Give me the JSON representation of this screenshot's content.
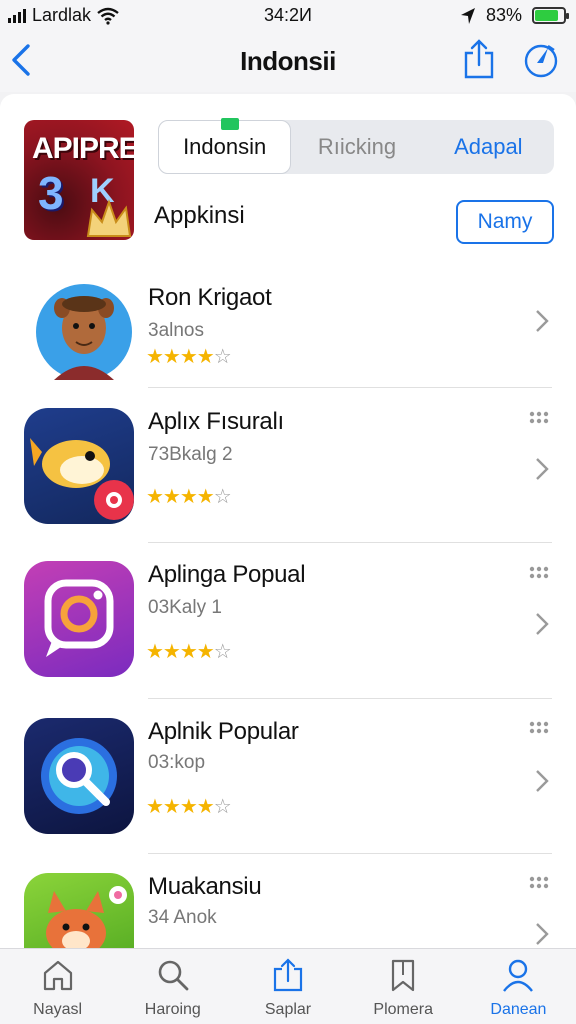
{
  "status_bar": {
    "carrier": "Lardlak",
    "time": "34:2И",
    "battery_percent": "83%",
    "battery_level": 0.83
  },
  "nav": {
    "title": "Indonsii",
    "back_icon": "chevron-left-icon",
    "share_icon": "share-icon",
    "compass_icon": "compass-icon"
  },
  "featured": {
    "icon_text_top": "APIPRE",
    "icon_text_num": "3",
    "icon_text_letter": "K",
    "segments": [
      "Indonsin",
      "Rıicking",
      "Adapal"
    ],
    "selected_segment": 0,
    "label": "Appkinsi",
    "action_label": "Namy"
  },
  "apps": [
    {
      "name": "Ron Krigaot",
      "subtitle": "3alnos",
      "rating": 4,
      "max_rating": 5
    },
    {
      "name": "Aplıx Fısuralı",
      "subtitle": "73Bkalg 2",
      "rating": 4,
      "max_rating": 5
    },
    {
      "name": "Aplinga Popual",
      "subtitle": "03Kaly 1",
      "rating": 4,
      "max_rating": 5
    },
    {
      "name": "Aplnik Popular",
      "subtitle": "03:kop",
      "rating": 4,
      "max_rating": 5
    },
    {
      "name": "Muakansiu",
      "subtitle": "34 Anok",
      "rating": 4,
      "max_rating": 5
    }
  ],
  "tabbar": {
    "tabs": [
      {
        "label": "Nayasl",
        "icon": "home-icon"
      },
      {
        "label": "Haroing",
        "icon": "search-icon"
      },
      {
        "label": "Saplar",
        "icon": "share-icon"
      },
      {
        "label": "Plomera",
        "icon": "bookmark-icon"
      },
      {
        "label": "Danean",
        "icon": "person-icon"
      }
    ],
    "active_index": 4
  },
  "colors": {
    "accent": "#1a73e8",
    "star": "#f5b400",
    "battery": "#2ecc40",
    "segment_indicator": "#22c55e"
  }
}
